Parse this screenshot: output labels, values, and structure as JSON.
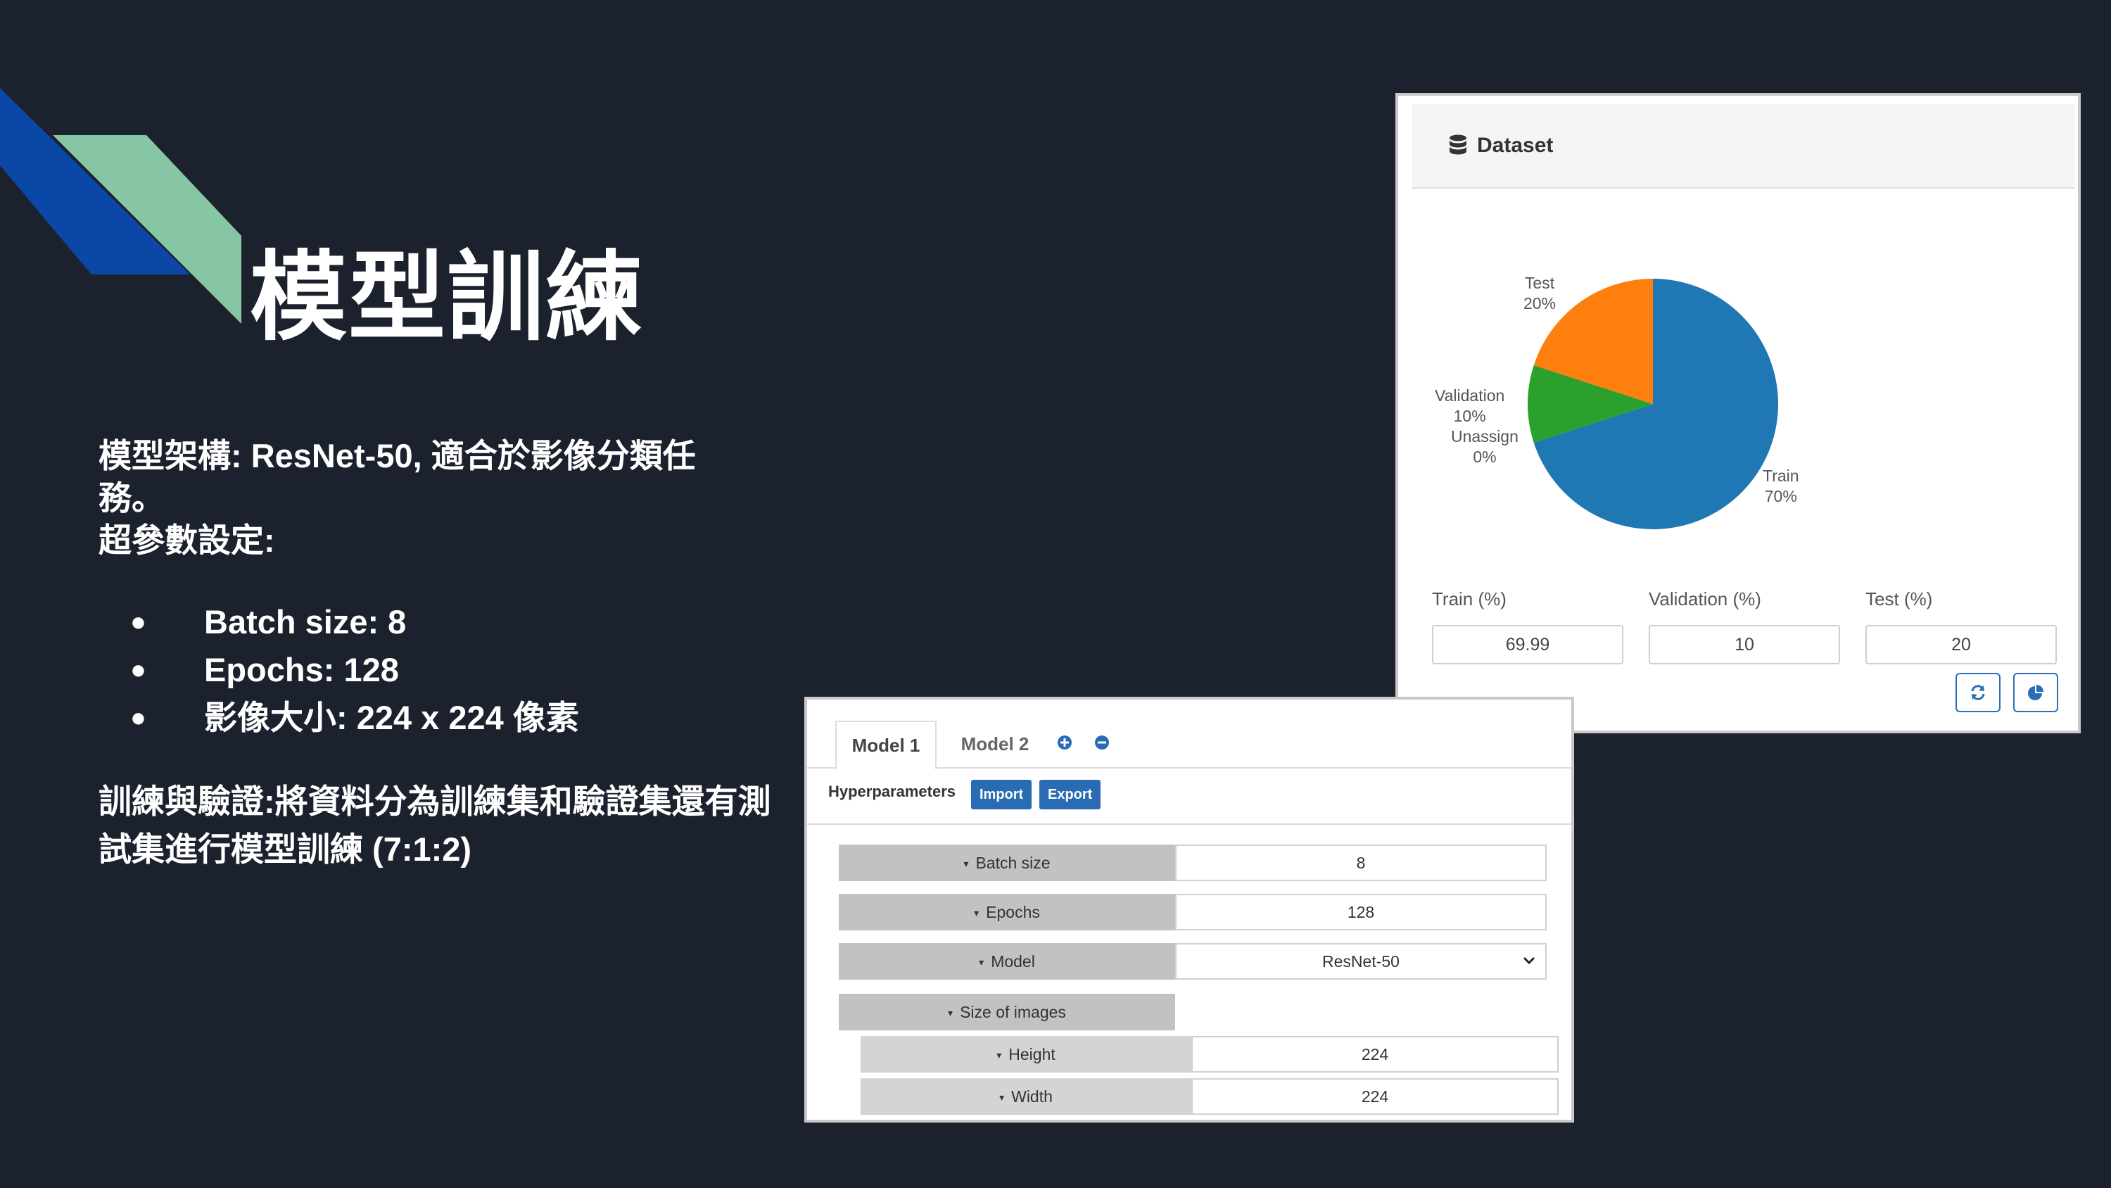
{
  "slide": {
    "title": "模型訓練",
    "architecture_text": "模型架構: ResNet-50, 適合於影像分類任務。",
    "hyperparam_heading": "超參數設定:",
    "hyperparams": [
      "Batch size: 8",
      "Epochs: 128",
      "影像大小: 224 x 224 像素"
    ],
    "bullet": "●",
    "training_text": "訓練與驗證:將資料分為訓練集和驗證集還有測試集進行模型訓練 (7:1:2)"
  },
  "dataset_panel": {
    "title": "Dataset",
    "header_icon": "database-icon",
    "pie_labels": [
      {
        "name": "Test",
        "pct": "20%"
      },
      {
        "name": "Validation",
        "pct": "10%"
      },
      {
        "name": "Unassign",
        "pct": "0%"
      },
      {
        "name": "Train",
        "pct": "70%"
      }
    ],
    "fields": [
      {
        "label": "Train (%)",
        "value": "69.99"
      },
      {
        "label": "Validation (%)",
        "value": "10"
      },
      {
        "label": "Test (%)",
        "value": "20"
      }
    ],
    "buttons": [
      "refresh-icon",
      "pie-chart-icon"
    ]
  },
  "chart_data": {
    "type": "pie",
    "categories": [
      "Train",
      "Validation",
      "Test",
      "Unassign"
    ],
    "values": [
      70,
      10,
      20,
      0
    ],
    "colors": [
      "#1f77b4",
      "#2ca02c",
      "#ff7f0e",
      "#d62728"
    ]
  },
  "model_panel": {
    "tabs": [
      "Model 1",
      "Model 2"
    ],
    "tab_icons": [
      "plus-circle-icon",
      "minus-circle-icon"
    ],
    "hyperparameters_label": "Hyperparameters",
    "import_label": "Import",
    "export_label": "Export",
    "caret": "▾",
    "params": {
      "batch_size": {
        "label": "Batch size",
        "value": "8"
      },
      "epochs": {
        "label": "Epochs",
        "value": "128"
      },
      "model": {
        "label": "Model",
        "value": "ResNet-50"
      },
      "size_of_images": {
        "label": "Size of images"
      },
      "height": {
        "label": "Height",
        "value": "224"
      },
      "width": {
        "label": "Width",
        "value": "224"
      }
    }
  },
  "colors": {
    "background": "#1c212e",
    "accent_blue": "#0b47a6",
    "accent_green": "#86c6a4",
    "button_blue": "#2a6cb4"
  }
}
